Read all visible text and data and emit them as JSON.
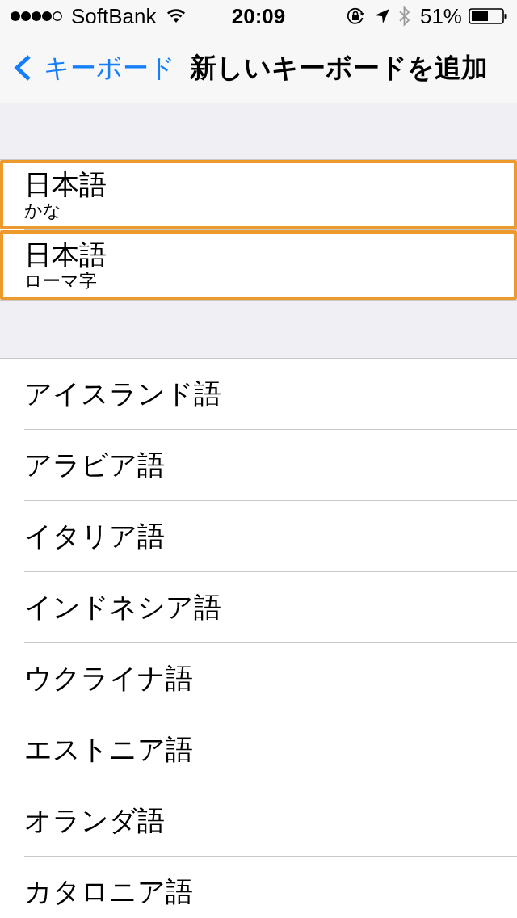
{
  "status_bar": {
    "carrier": "SoftBank",
    "time": "20:09",
    "battery": "51%"
  },
  "nav_bar": {
    "back": "キーボード",
    "title": "新しいキーボードを追加"
  },
  "suggested": [
    {
      "title": "日本語",
      "subtitle": "かな",
      "highlighted": true
    },
    {
      "title": "日本語",
      "subtitle": "ローマ字",
      "highlighted": true
    }
  ],
  "languages": [
    "アイスランド語",
    "アラビア語",
    "イタリア語",
    "インドネシア語",
    "ウクライナ語",
    "エストニア語",
    "オランダ語",
    "カタロニア語"
  ]
}
